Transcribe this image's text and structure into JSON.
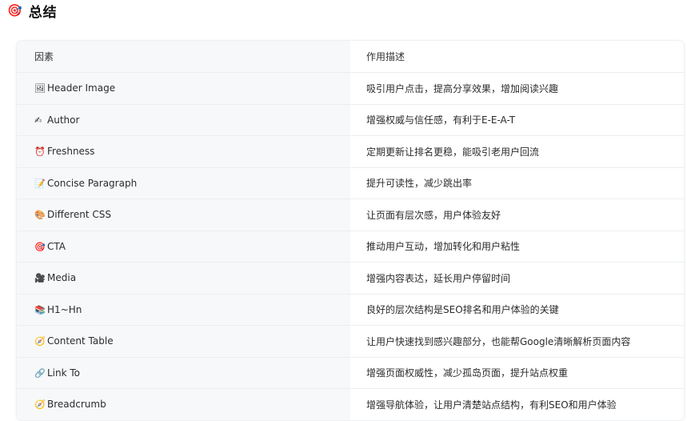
{
  "heading": {
    "icon": "🎯",
    "title": "总结"
  },
  "table": {
    "headers": [
      "因素",
      "作用描述"
    ],
    "rows": [
      {
        "icon": "🖼",
        "factor": "Header Image",
        "desc": "吸引用户点击，提高分享效果，增加阅读兴趣"
      },
      {
        "icon": "✍",
        "factor": "Author",
        "desc": "增强权威与信任感，有利于E-E-A-T"
      },
      {
        "icon": "⏰",
        "factor": "Freshness",
        "desc": "定期更新让排名更稳，能吸引老用户回流"
      },
      {
        "icon": "📝",
        "factor": "Concise Paragraph",
        "desc": "提升可读性，减少跳出率"
      },
      {
        "icon": "🎨",
        "factor": "Different CSS",
        "desc": "让页面有层次感，用户体验友好"
      },
      {
        "icon": "🎯",
        "factor": "CTA",
        "desc": "推动用户互动，增加转化和用户粘性"
      },
      {
        "icon": "🎥",
        "factor": "Media",
        "desc": "增强内容表达，延长用户停留时间"
      },
      {
        "icon": "📚",
        "factor": "H1~Hn",
        "desc": "良好的层次结构是SEO排名和用户体验的关键"
      },
      {
        "icon": "🧭",
        "factor": "Content Table",
        "desc": "让用户快速找到感兴趣部分，也能帮Google清晰解析页面内容"
      },
      {
        "icon": "🔗",
        "factor": "Link To",
        "desc": "增强页面权威性，减少孤岛页面，提升站点权重"
      },
      {
        "icon": "🧭",
        "factor": "Breadcrumb",
        "desc": "增强导航体验，让用户清楚站点结构，有利SEO和用户体验"
      }
    ]
  }
}
